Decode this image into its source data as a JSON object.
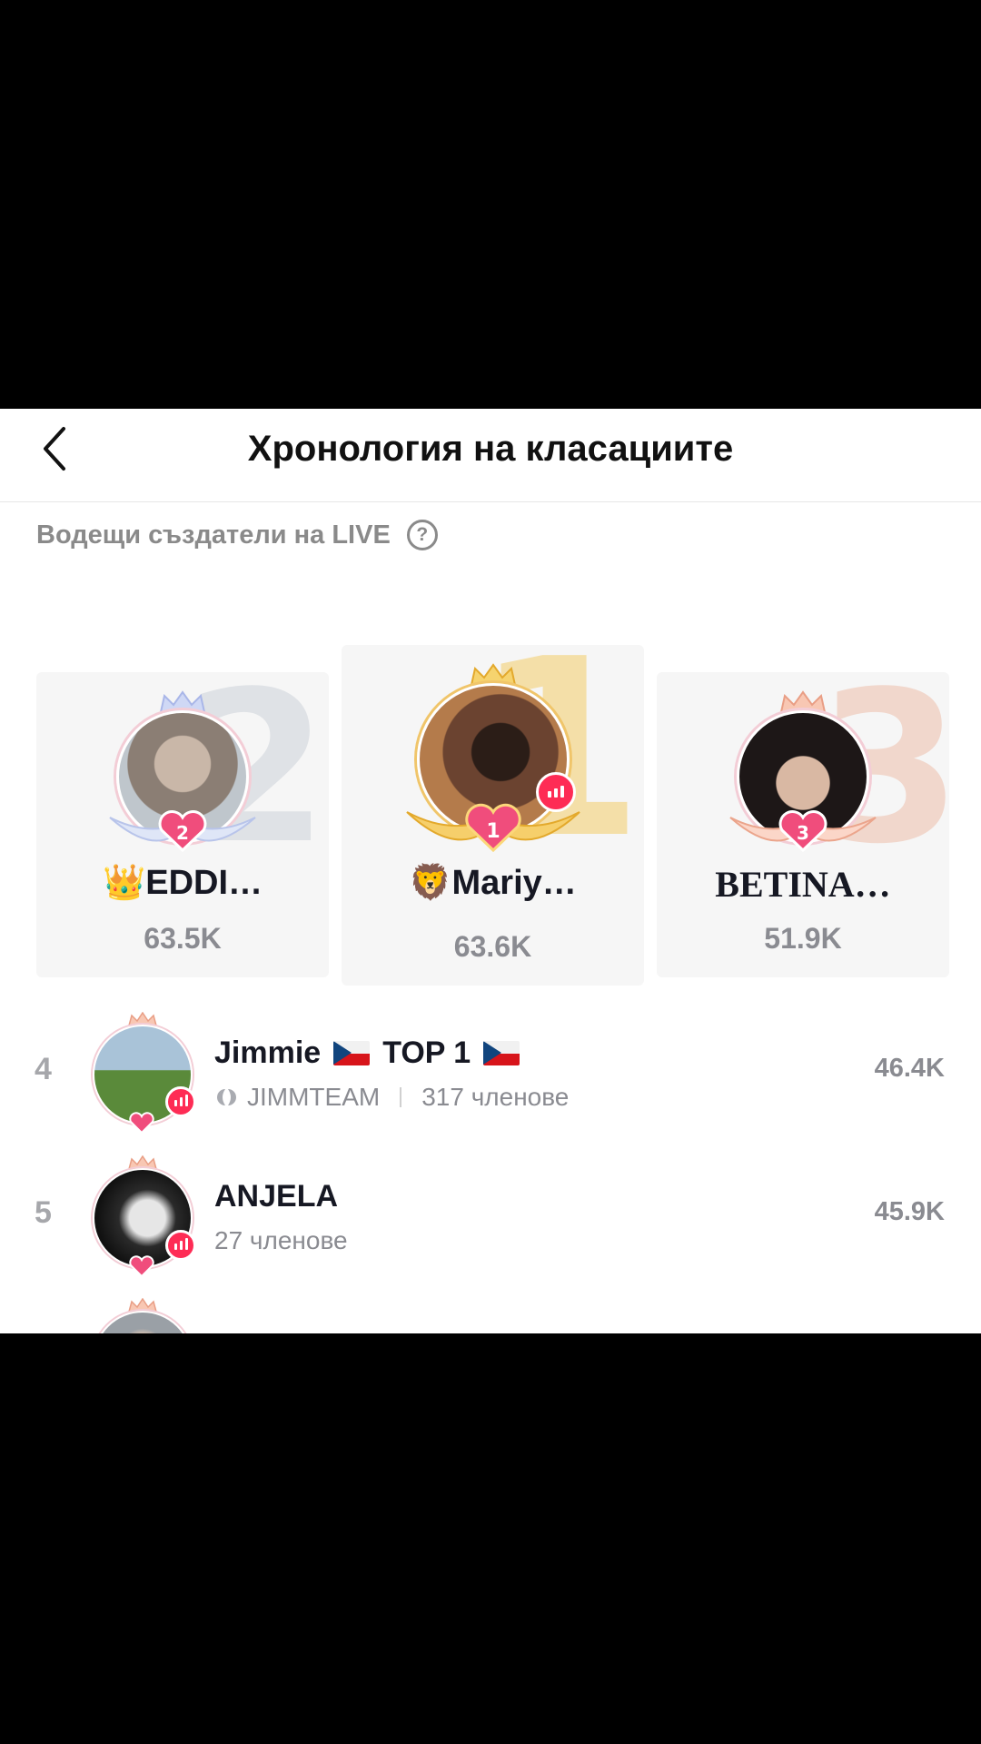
{
  "header": {
    "title": "Хронология на класациите"
  },
  "section": {
    "label": "Водещи създатели на LIVE"
  },
  "podium": [
    {
      "rank": "2",
      "name": "👑EDDI…",
      "score": "63.5K",
      "avatar_color": "#8b7e74"
    },
    {
      "rank": "1",
      "name": "🦁Mariy…",
      "score": "63.6K",
      "avatar_color": "#5a3a2a"
    },
    {
      "rank": "3",
      "name": "BETINA…",
      "score": "51.9K",
      "avatar_color": "#3b3030"
    }
  ],
  "list": [
    {
      "rank": "4",
      "name": "Jimmie",
      "tag": "TOP 1",
      "team": "JIMMTEAM",
      "members": "317 членове",
      "score": "46.4K",
      "avatar_color": "#4f7d3a"
    },
    {
      "rank": "5",
      "name": "ANJELA",
      "members": "27 членове",
      "score": "45.9K",
      "avatar_color": "#2a2a2a"
    },
    {
      "rank": "",
      "name": "",
      "score": "",
      "avatar_color": "#9aa0a6"
    }
  ],
  "colors": {
    "live": "#fe2c55",
    "gold": "#f0c56a",
    "text": "#161823",
    "muted": "#8a8b91"
  }
}
